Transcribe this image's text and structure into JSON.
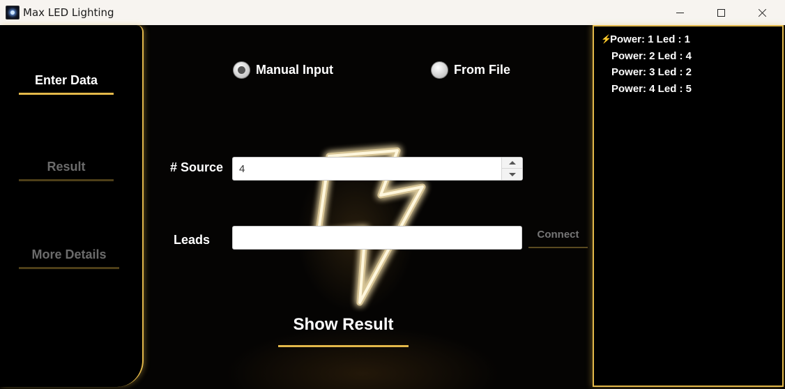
{
  "window": {
    "title": "Max LED Lighting",
    "controls": {
      "minimize": "minimize",
      "maximize": "maximize",
      "close": "close"
    }
  },
  "sidebar": {
    "items": [
      {
        "label": "Enter Data",
        "active": true
      },
      {
        "label": "Result",
        "active": false
      },
      {
        "label": "More Details",
        "active": false
      }
    ]
  },
  "input_mode": {
    "options": [
      {
        "label": "Manual Input",
        "selected": true
      },
      {
        "label": "From File",
        "selected": false
      }
    ]
  },
  "form": {
    "source_label": "# Source",
    "source_value": "4",
    "leads_label": "Leads",
    "leads_value": "",
    "connect_label": "Connect",
    "show_result_label": "Show Result"
  },
  "output": {
    "lines": [
      "Power: 1 Led : 1",
      "Power: 2 Led : 4",
      "Power: 3 Led : 2",
      "Power: 4 Led : 5"
    ]
  },
  "colors": {
    "accent": "#e3b84a",
    "background": "#000000",
    "inactive_text": "#6b6b6b"
  }
}
